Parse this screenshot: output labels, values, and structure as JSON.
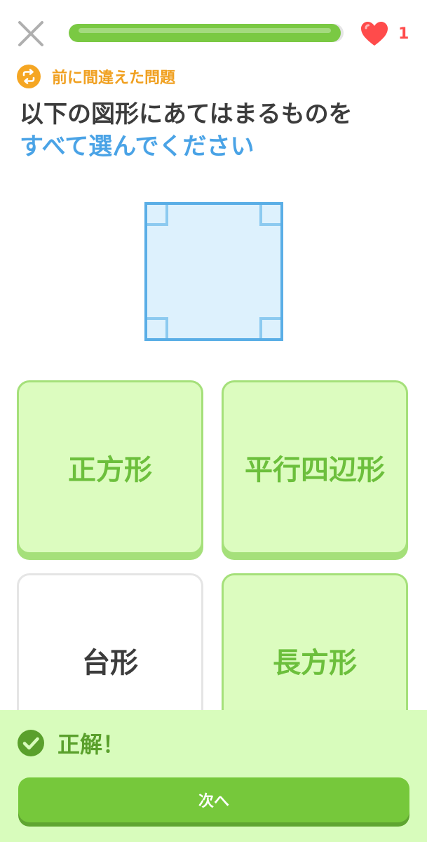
{
  "top_bar": {
    "close_icon": "close-icon",
    "progress_fraction": 0.99,
    "hearts_count": "1",
    "heart_icon": "heart-icon"
  },
  "review_tag": {
    "icon": "repeat-icon",
    "label": "前に間違えた問題"
  },
  "prompt": {
    "line1": "以下の図形にあてはまるものを",
    "line2": "すべて選んでください"
  },
  "figure": {
    "shape": "square",
    "fill_color": "#ddf1fd",
    "stroke_color": "#5aaee6"
  },
  "options": [
    {
      "label": "正方形",
      "selected": true
    },
    {
      "label": "平行四辺形",
      "selected": true
    },
    {
      "label": "台形",
      "selected": false
    },
    {
      "label": "長方形",
      "selected": true
    }
  ],
  "feedback": {
    "icon": "check-circle-icon",
    "text": "正解！",
    "button_label": "次へ"
  },
  "colors": {
    "accent_green": "#76c83b",
    "selected_card_bg": "#dcfcbf",
    "prompt_blue": "#4aa3e6",
    "review_orange": "#f5a623",
    "heart_red": "#ff4b4b"
  }
}
